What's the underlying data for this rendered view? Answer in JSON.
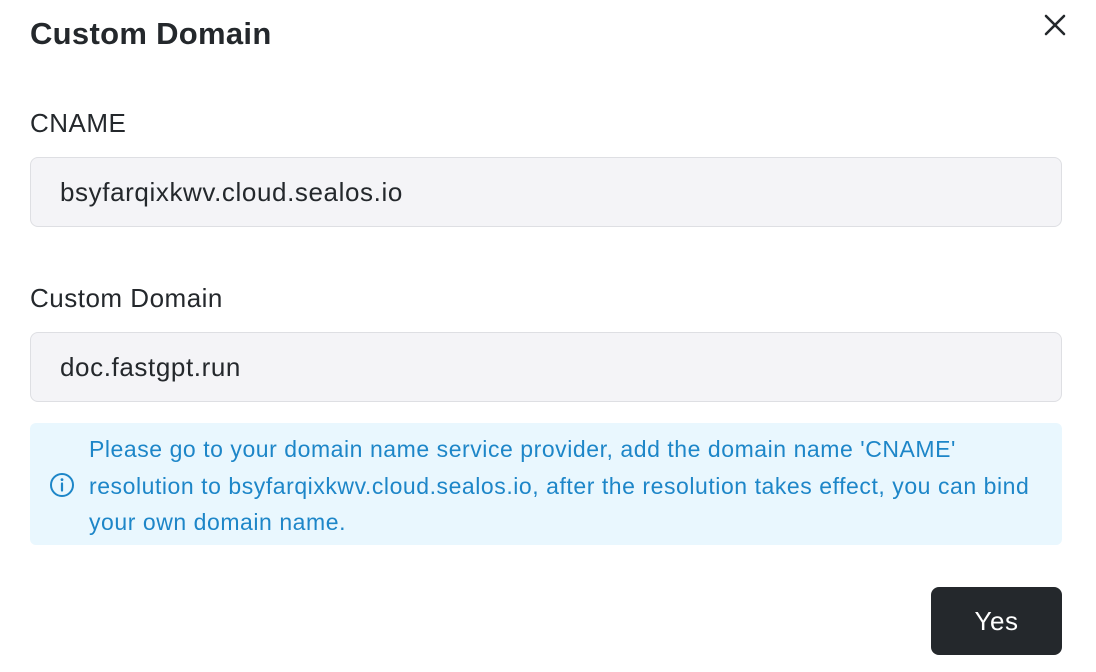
{
  "modal": {
    "title": "Custom Domain",
    "close_icon": "close-icon"
  },
  "cname": {
    "label": "CNAME",
    "value": "bsyfarqixkwv.cloud.sealos.io"
  },
  "custom_domain": {
    "label": "Custom Domain",
    "value": "doc.fastgpt.run"
  },
  "alert": {
    "icon": "info-icon",
    "text": "Please go to your domain name service provider, add the domain name 'CNAME' resolution to bsyfarqixkwv.cloud.sealos.io, after the resolution takes effect, you can bind your own domain name.",
    "color": "#1d86c8",
    "background": "#e9f7fe"
  },
  "footer": {
    "confirm_label": "Yes"
  },
  "colors": {
    "primary_button": "#24282c",
    "input_background": "#f4f4f7"
  }
}
